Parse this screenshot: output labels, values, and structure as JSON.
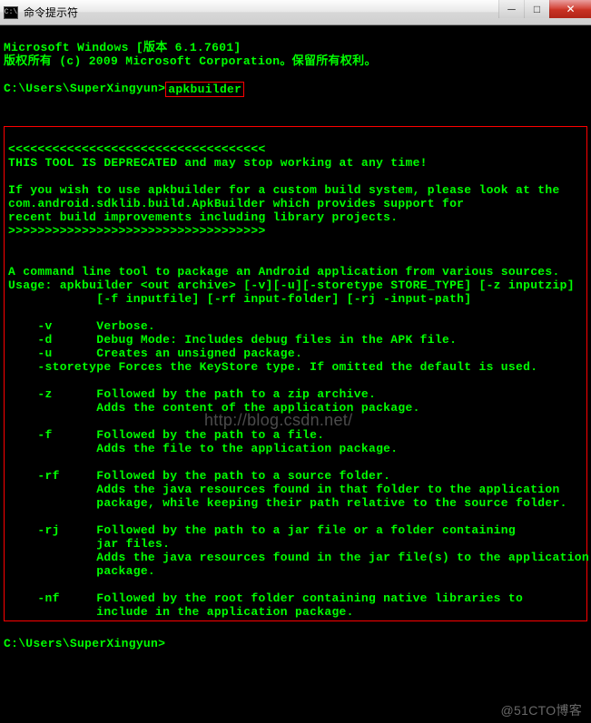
{
  "window": {
    "icon_label": "C:\\",
    "title": "命令提示符"
  },
  "header": {
    "line1": "Microsoft Windows [版本 6.1.7601]",
    "line2": "版权所有 (c) 2009 Microsoft Corporation。保留所有权利。"
  },
  "prompt1": {
    "path": "C:\\Users\\SuperXingyun>",
    "command": "apkbuilder"
  },
  "output": {
    "arrows_open": "<<<<<<<<<<<<<<<<<<<<<<<<<<<<<<<<<<<",
    "deprecated": "THIS TOOL IS DEPRECATED and may stop working at any time!",
    "wish1": "If you wish to use apkbuilder for a custom build system, please look at the",
    "wish2": "com.android.sdklib.build.ApkBuilder which provides support for",
    "wish3": "recent build improvements including library projects.",
    "arrows_close": ">>>>>>>>>>>>>>>>>>>>>>>>>>>>>>>>>>>",
    "desc": "A command line tool to package an Android application from various sources.",
    "usage1": "Usage: apkbuilder <out archive> [-v][-u][-storetype STORE_TYPE] [-z inputzip]",
    "usage2": "            [-f inputfile] [-rf input-folder] [-rj -input-path]",
    "opt_v": "    -v      Verbose.",
    "opt_d": "    -d      Debug Mode: Includes debug files in the APK file.",
    "opt_u": "    -u      Creates an unsigned package.",
    "opt_st": "    -storetype Forces the KeyStore type. If omitted the default is used.",
    "opt_z1": "    -z      Followed by the path to a zip archive.",
    "opt_z2": "            Adds the content of the application package.",
    "opt_f1": "    -f      Followed by the path to a file.",
    "opt_f2": "            Adds the file to the application package.",
    "opt_rf1": "    -rf     Followed by the path to a source folder.",
    "opt_rf2": "            Adds the java resources found in that folder to the application",
    "opt_rf3": "            package, while keeping their path relative to the source folder.",
    "opt_rj1": "    -rj     Followed by the path to a jar file or a folder containing",
    "opt_rj2": "            jar files.",
    "opt_rj3": "            Adds the java resources found in the jar file(s) to the application",
    "opt_rj4": "            package.",
    "opt_nf1": "    -nf     Followed by the root folder containing native libraries to",
    "opt_nf2": "            include in the application package."
  },
  "prompt2": {
    "path": "C:\\Users\\SuperXingyun>"
  },
  "watermarks": {
    "w1": "http://blog.csdn.net/",
    "w2": "@51CTO博客"
  }
}
